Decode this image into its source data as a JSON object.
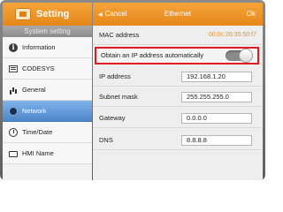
{
  "sidebar": {
    "app_title": "Setting",
    "subtitle": "System setting",
    "items": [
      {
        "label": "Information",
        "icon": "info-icon"
      },
      {
        "label": "CODESYS",
        "icon": "codesys-icon"
      },
      {
        "label": "General",
        "icon": "general-icon"
      },
      {
        "label": "Network",
        "icon": "network-icon",
        "active": true
      },
      {
        "label": "Time/Date",
        "icon": "clock-icon"
      },
      {
        "label": "HMI Name",
        "icon": "hmi-icon"
      }
    ]
  },
  "panel": {
    "cancel_label": "Cancel",
    "title": "Ethernet",
    "ok_label": "Ok",
    "mac_label": "MAC address",
    "mac_value": "00:0c:26:35:50:f7",
    "dhcp_label": "Obtain an IP address automatically",
    "dhcp_enabled": false,
    "ip_label": "IP address",
    "ip_value": "192.168.1.20",
    "mask_label": "Subnet mask",
    "mask_value": "255.255.255.0",
    "gateway_label": "Gateway",
    "gateway_value": "0.0.0.0",
    "dns_label": "DNS",
    "dns_value": "8.8.8.8"
  },
  "colors": {
    "header_orange": "#ee9528",
    "active_blue": "#5a93d6",
    "highlight_red": "#e01b24",
    "mac_orange": "#e3922d"
  }
}
